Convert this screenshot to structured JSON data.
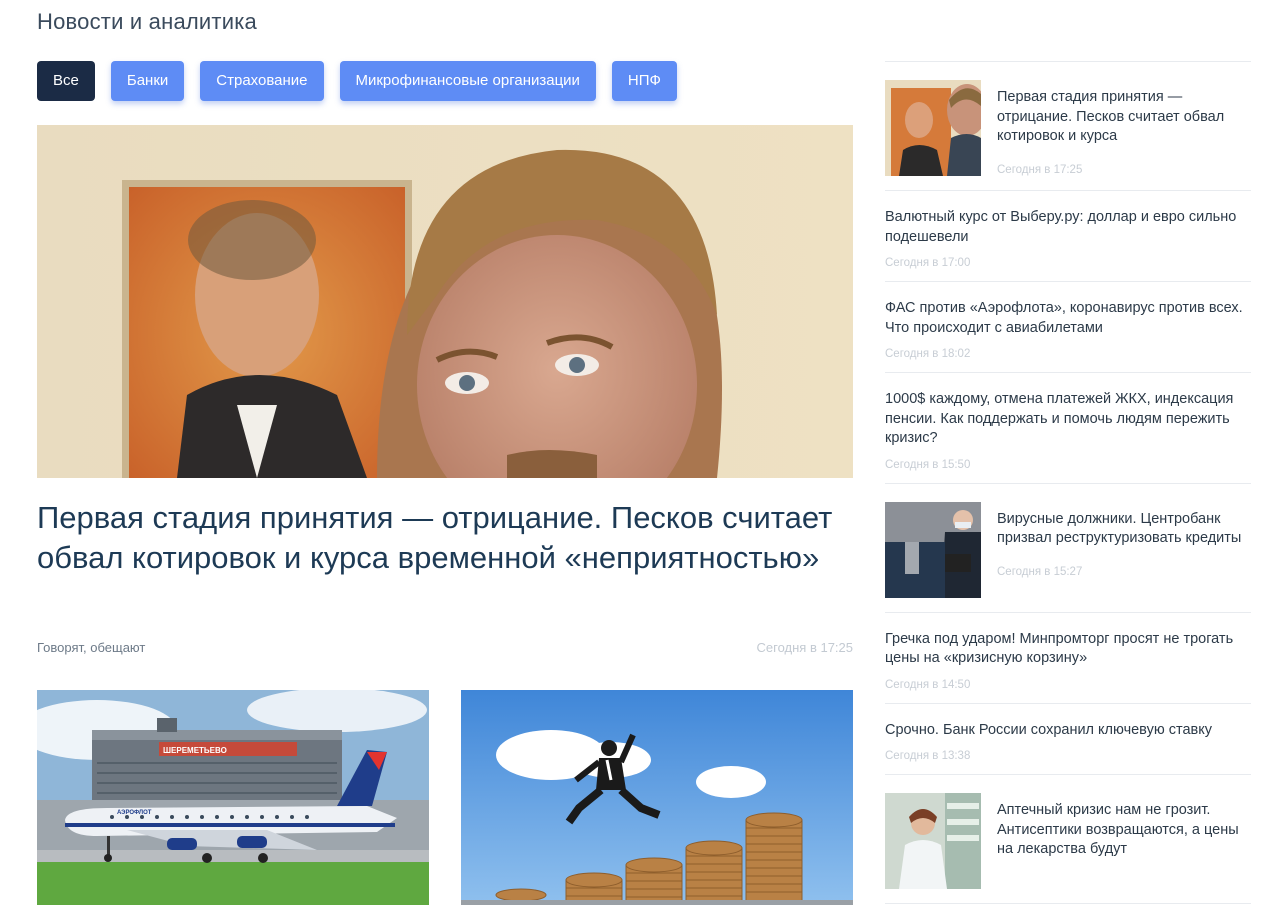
{
  "page": {
    "title": "Новости и аналитика"
  },
  "filters": [
    {
      "label": "Все",
      "active": true
    },
    {
      "label": "Банки"
    },
    {
      "label": "Страхование"
    },
    {
      "label": "Микрофинансовые организации"
    },
    {
      "label": "НПФ"
    }
  ],
  "hero": {
    "title": "Первая стадия принятия — отрицание. Песков считает обвал котировок и курса временной «неприятностью»",
    "tag": "Говорят, обещают",
    "time": "Сегодня в 17:25"
  },
  "sidebar": {
    "items": [
      {
        "title": "Первая стадия принятия — отрицание. Песков считает обвал котировок и курса",
        "time": "Сегодня в 17:25"
      },
      {
        "title": "Валютный курс от Выберу.ру: доллар и евро сильно подешевели",
        "time": "Сегодня в 17:00"
      },
      {
        "title": "ФАС против «Аэрофлота», коронавирус против всех. Что происходит с авиабилетами",
        "time": "Сегодня в 18:02"
      },
      {
        "title": "1000$ каждому, отмена платежей ЖКХ, индексация пенсии. Как поддержать и помочь людям пережить кризис?",
        "time": "Сегодня в 15:50"
      },
      {
        "title": "Вирусные должники. Центробанк призвал реструктуризовать кредиты",
        "time": "Сегодня в 15:27"
      },
      {
        "title": "Гречка под ударом! Минпромторг просят не трогать цены на «кризисную корзину»",
        "time": "Сегодня в 14:50"
      },
      {
        "title": "Срочно. Банк России сохранил ключевую ставку",
        "time": "Сегодня в 13:38"
      },
      {
        "title": "Аптечный кризис нам не грозит. Антисептики возвращаются, а цены на лекарства будут"
      }
    ]
  },
  "images": {
    "airport_sign": "ШЕРЕМЕТЬЕВО",
    "aircraft_brand": "АЭРОФЛОТ"
  }
}
